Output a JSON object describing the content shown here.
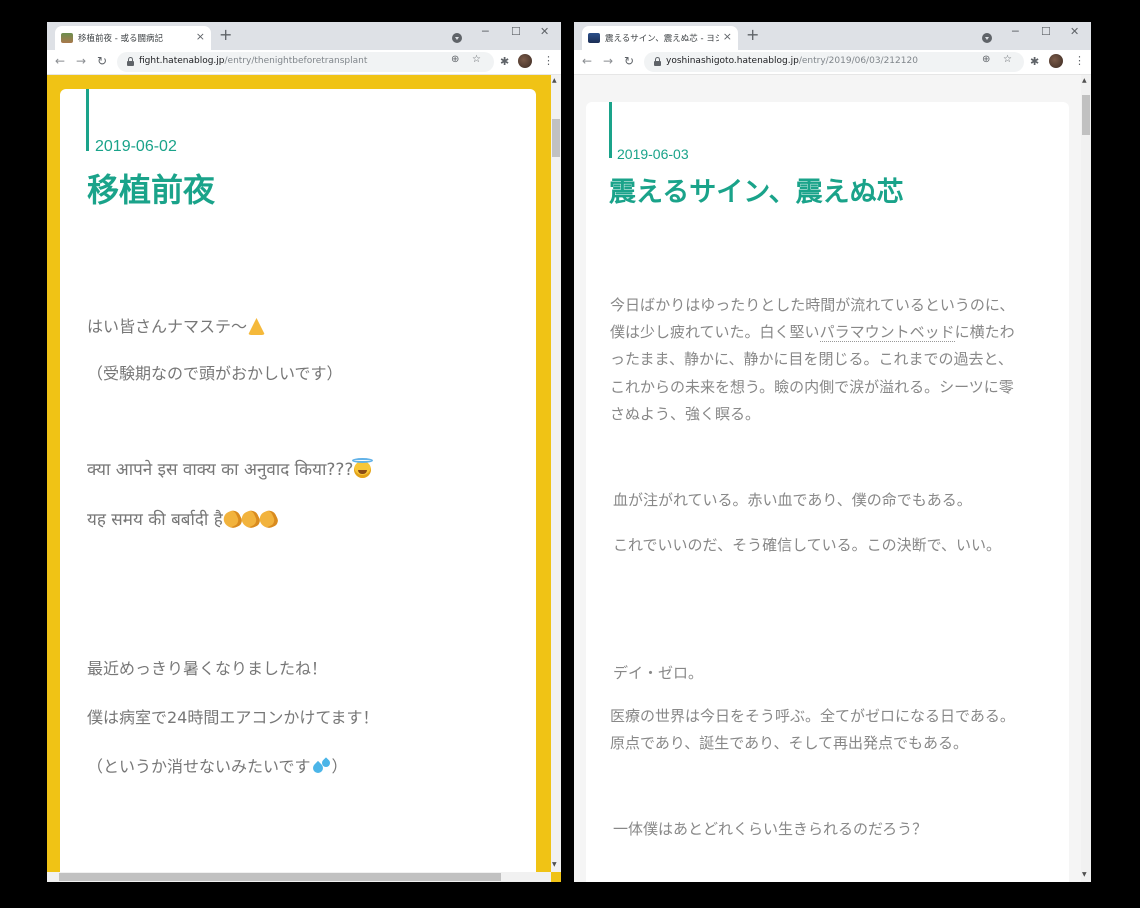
{
  "left_window": {
    "tab_title": "移植前夜 - 或る闘病記",
    "url_host": "fight.hatenablog.jp",
    "url_path": "/entry/thenightbeforetransplant",
    "post": {
      "date": "2019-06-02",
      "title": "移植前夜",
      "paragraphs": [
        "はい皆さんナマステ〜",
        "（受験期なので頭がおかしいです）",
        "क्या आपने इस वाक्य का अनुवाद किया???",
        "यह समय की बर्बादी है",
        "最近めっきり暑くなりましたね！",
        "僕は病室で24時間エアコンかけてます！",
        "（というか消せないみたいです",
        "）"
      ]
    }
  },
  "right_window": {
    "tab_title": "震えるサイン、震えぬ芯 - ヨシナシゴト",
    "url_host": "yoshinashigoto.hatenablog.jp",
    "url_path": "/entry/2019/06/03/212120",
    "post": {
      "date": "2019-06-03",
      "title": "震えるサイン、震えぬ芯",
      "para1": {
        "line1": "今日ばかりはゆったりとした時間が流れているというのに、",
        "line2_pre": "僕は少し疲れていた。白く堅い",
        "link": "パラマウントベッド",
        "line2_post": "に横たわ",
        "line3": "ったまま、静かに、静かに目を閉じる。これまでの過去と、",
        "line4": "これからの未来を想う。瞼の内側で涙が溢れる。シーツに零",
        "line5": "さぬよう、強く瞑る。"
      },
      "para2": "血が注がれている。赤い血であり、僕の命でもある。",
      "para3": "これでいいのだ、そう確信している。この決断で、いい。",
      "para4": "デイ・ゼロ。",
      "para5": {
        "line1": "医療の世界は今日をそう呼ぶ。全てがゼロになる日である。",
        "line2": "原点であり、誕生であり、そして再出発点でもある。"
      },
      "para6": "一体僕はあとどれくらい生きられるのだろう？"
    }
  },
  "chrome": {
    "tab_close": "×",
    "new_tab": "+",
    "minimize": "─",
    "maximize": "☐",
    "close": "✕",
    "back": "←",
    "forward": "→",
    "reload": "↻",
    "zoom_icon": "⊕",
    "star_icon": "☆",
    "extensions_icon": "✱",
    "menu_icon": "⋮"
  },
  "colors": {
    "accent": "#1aa38a",
    "left_background": "#f0c315",
    "right_background": "#f5f5f5"
  },
  "icons": [
    "favicon",
    "tab-search-icon",
    "lock-icon",
    "zoom-icon",
    "star-icon",
    "extensions-icon",
    "profile-avatar",
    "menu-icon",
    "folded-hands-emoji",
    "smiling-face-with-halo-emoji",
    "clapping-hands-emoji",
    "sweat-droplets-emoji"
  ]
}
